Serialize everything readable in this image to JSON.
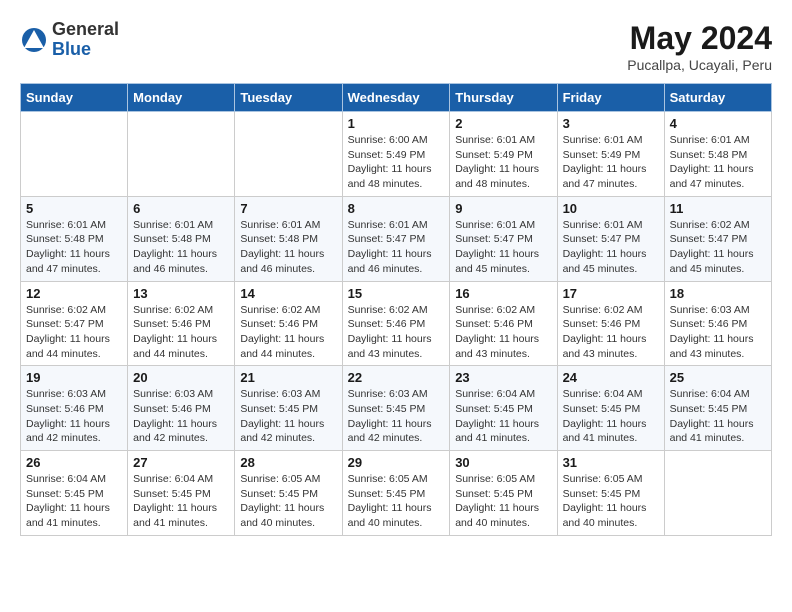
{
  "logo": {
    "general": "General",
    "blue": "Blue"
  },
  "title": "May 2024",
  "location": "Pucallpa, Ucayali, Peru",
  "weekdays": [
    "Sunday",
    "Monday",
    "Tuesday",
    "Wednesday",
    "Thursday",
    "Friday",
    "Saturday"
  ],
  "weeks": [
    [
      {
        "day": "",
        "info": ""
      },
      {
        "day": "",
        "info": ""
      },
      {
        "day": "",
        "info": ""
      },
      {
        "day": "1",
        "info": "Sunrise: 6:00 AM\nSunset: 5:49 PM\nDaylight: 11 hours\nand 48 minutes."
      },
      {
        "day": "2",
        "info": "Sunrise: 6:01 AM\nSunset: 5:49 PM\nDaylight: 11 hours\nand 48 minutes."
      },
      {
        "day": "3",
        "info": "Sunrise: 6:01 AM\nSunset: 5:49 PM\nDaylight: 11 hours\nand 47 minutes."
      },
      {
        "day": "4",
        "info": "Sunrise: 6:01 AM\nSunset: 5:48 PM\nDaylight: 11 hours\nand 47 minutes."
      }
    ],
    [
      {
        "day": "5",
        "info": "Sunrise: 6:01 AM\nSunset: 5:48 PM\nDaylight: 11 hours\nand 47 minutes."
      },
      {
        "day": "6",
        "info": "Sunrise: 6:01 AM\nSunset: 5:48 PM\nDaylight: 11 hours\nand 46 minutes."
      },
      {
        "day": "7",
        "info": "Sunrise: 6:01 AM\nSunset: 5:48 PM\nDaylight: 11 hours\nand 46 minutes."
      },
      {
        "day": "8",
        "info": "Sunrise: 6:01 AM\nSunset: 5:47 PM\nDaylight: 11 hours\nand 46 minutes."
      },
      {
        "day": "9",
        "info": "Sunrise: 6:01 AM\nSunset: 5:47 PM\nDaylight: 11 hours\nand 45 minutes."
      },
      {
        "day": "10",
        "info": "Sunrise: 6:01 AM\nSunset: 5:47 PM\nDaylight: 11 hours\nand 45 minutes."
      },
      {
        "day": "11",
        "info": "Sunrise: 6:02 AM\nSunset: 5:47 PM\nDaylight: 11 hours\nand 45 minutes."
      }
    ],
    [
      {
        "day": "12",
        "info": "Sunrise: 6:02 AM\nSunset: 5:47 PM\nDaylight: 11 hours\nand 44 minutes."
      },
      {
        "day": "13",
        "info": "Sunrise: 6:02 AM\nSunset: 5:46 PM\nDaylight: 11 hours\nand 44 minutes."
      },
      {
        "day": "14",
        "info": "Sunrise: 6:02 AM\nSunset: 5:46 PM\nDaylight: 11 hours\nand 44 minutes."
      },
      {
        "day": "15",
        "info": "Sunrise: 6:02 AM\nSunset: 5:46 PM\nDaylight: 11 hours\nand 43 minutes."
      },
      {
        "day": "16",
        "info": "Sunrise: 6:02 AM\nSunset: 5:46 PM\nDaylight: 11 hours\nand 43 minutes."
      },
      {
        "day": "17",
        "info": "Sunrise: 6:02 AM\nSunset: 5:46 PM\nDaylight: 11 hours\nand 43 minutes."
      },
      {
        "day": "18",
        "info": "Sunrise: 6:03 AM\nSunset: 5:46 PM\nDaylight: 11 hours\nand 43 minutes."
      }
    ],
    [
      {
        "day": "19",
        "info": "Sunrise: 6:03 AM\nSunset: 5:46 PM\nDaylight: 11 hours\nand 42 minutes."
      },
      {
        "day": "20",
        "info": "Sunrise: 6:03 AM\nSunset: 5:46 PM\nDaylight: 11 hours\nand 42 minutes."
      },
      {
        "day": "21",
        "info": "Sunrise: 6:03 AM\nSunset: 5:45 PM\nDaylight: 11 hours\nand 42 minutes."
      },
      {
        "day": "22",
        "info": "Sunrise: 6:03 AM\nSunset: 5:45 PM\nDaylight: 11 hours\nand 42 minutes."
      },
      {
        "day": "23",
        "info": "Sunrise: 6:04 AM\nSunset: 5:45 PM\nDaylight: 11 hours\nand 41 minutes."
      },
      {
        "day": "24",
        "info": "Sunrise: 6:04 AM\nSunset: 5:45 PM\nDaylight: 11 hours\nand 41 minutes."
      },
      {
        "day": "25",
        "info": "Sunrise: 6:04 AM\nSunset: 5:45 PM\nDaylight: 11 hours\nand 41 minutes."
      }
    ],
    [
      {
        "day": "26",
        "info": "Sunrise: 6:04 AM\nSunset: 5:45 PM\nDaylight: 11 hours\nand 41 minutes."
      },
      {
        "day": "27",
        "info": "Sunrise: 6:04 AM\nSunset: 5:45 PM\nDaylight: 11 hours\nand 41 minutes."
      },
      {
        "day": "28",
        "info": "Sunrise: 6:05 AM\nSunset: 5:45 PM\nDaylight: 11 hours\nand 40 minutes."
      },
      {
        "day": "29",
        "info": "Sunrise: 6:05 AM\nSunset: 5:45 PM\nDaylight: 11 hours\nand 40 minutes."
      },
      {
        "day": "30",
        "info": "Sunrise: 6:05 AM\nSunset: 5:45 PM\nDaylight: 11 hours\nand 40 minutes."
      },
      {
        "day": "31",
        "info": "Sunrise: 6:05 AM\nSunset: 5:45 PM\nDaylight: 11 hours\nand 40 minutes."
      },
      {
        "day": "",
        "info": ""
      }
    ]
  ]
}
